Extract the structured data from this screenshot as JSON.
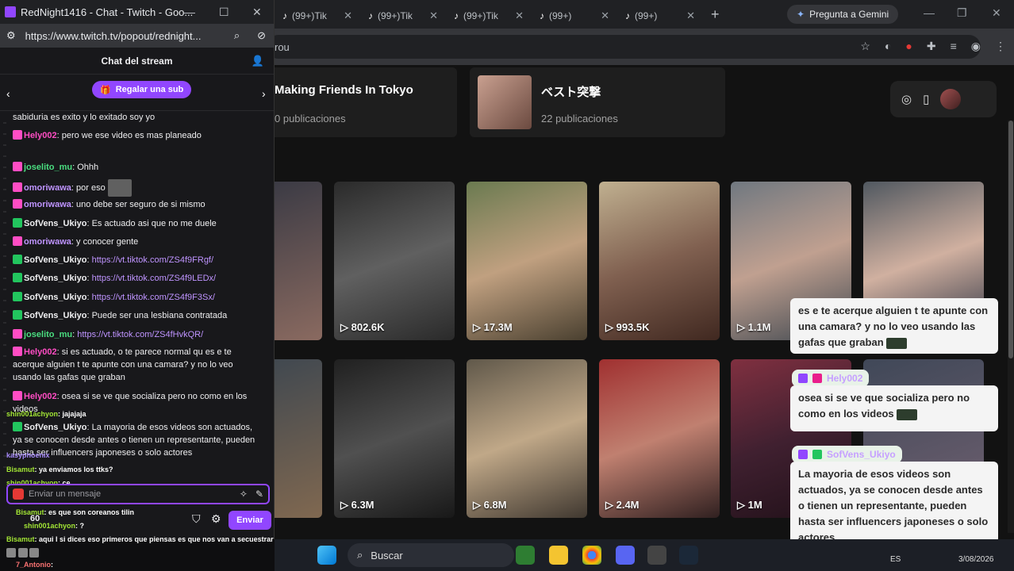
{
  "browser": {
    "tabs": [
      {
        "label": "(99+)Tik"
      },
      {
        "label": "(99+)Tik"
      },
      {
        "label": "(99+)Tik"
      },
      {
        "label": "(99+)"
      },
      {
        "label": "(99+)"
      }
    ],
    "gemini_label": "Pregunta a Gemini",
    "address_text": "rou"
  },
  "page": {
    "cards": [
      {
        "title": "Making Friends In Tokyo",
        "subtitle": "0 publicaciones"
      },
      {
        "title": "ベスト突撃",
        "subtitle": "22 publicaciones"
      }
    ],
    "videos_row1": [
      {
        "count": ""
      },
      {
        "count": "802.6K"
      },
      {
        "count": "17.3M"
      },
      {
        "count": "993.5K"
      },
      {
        "count": "1.1M"
      },
      {
        "count": ""
      }
    ],
    "videos_row2": [
      {
        "count": ""
      },
      {
        "count": "6.3M"
      },
      {
        "count": "6.8M"
      },
      {
        "count": "2.4M"
      },
      {
        "count": "1M"
      },
      {
        "count": ""
      }
    ]
  },
  "overlay": {
    "bubble1": "es e te acerque alguien t te apunte con una camara? y no lo veo usando las gafas que graban",
    "name2": "Hely002",
    "bubble2": "osea si se ve que socializa pero no como en los videos",
    "name3": "SofVens_Ukiyo",
    "bubble3": "La mayoria de esos videos son actuados, ya se conocen desde antes o tienen un representante, pueden hasta ser influencers japoneses o solo actores"
  },
  "taskbar": {
    "search_label": "Buscar",
    "lang": "ES",
    "date": "3/08/2026"
  },
  "popup": {
    "window_title": "RedNight1416 - Chat - Twitch - Goo...",
    "url": "https://www.twitch.tv/popout/rednight...",
    "chat_title": "Chat del stream",
    "gift_label": "Regalar una sub",
    "input_placeholder": "Enviar un mensaje",
    "send_label": "Enviar",
    "points": "60"
  },
  "messages": [
    {
      "user": "",
      "text": "sabiduria es exito y lo exitado soy yo",
      "color": "#efeff1"
    },
    {
      "user": "Hely002",
      "text": ": pero we ese video es mas planeado",
      "color": "#ff4dc4"
    },
    {
      "user": "joselito_mu",
      "text": ": Ohhh",
      "color": "#4ade80"
    },
    {
      "user": "omoriwawa",
      "text": ": por eso",
      "color": "#bf94ff"
    },
    {
      "user": "omoriwawa",
      "text": ": uno debe ser seguro de si mismo",
      "color": "#bf94ff"
    },
    {
      "user": "SofVens_Ukiyo",
      "text": ": Es actuado asi que no me duele",
      "color": "#efeff1"
    },
    {
      "user": "omoriwawa",
      "text": ": y conocer gente",
      "color": "#bf94ff"
    },
    {
      "user": "SofVens_Ukiyo",
      "text": ": ",
      "link": "https://vt.tiktok.com/ZS4f9FRgf/",
      "color": "#efeff1"
    },
    {
      "user": "SofVens_Ukiyo",
      "text": ": ",
      "link": "https://vt.tiktok.com/ZS4f9LEDx/",
      "color": "#efeff1"
    },
    {
      "user": "SofVens_Ukiyo",
      "text": ": ",
      "link": "https://vt.tiktok.com/ZS4f9F3Sx/",
      "color": "#efeff1"
    },
    {
      "user": "SofVens_Ukiyo",
      "text": ": Puede ser una lesbiana contratada",
      "color": "#efeff1"
    },
    {
      "user": "joselito_mu",
      "text": ": ",
      "link": "https://vt.tiktok.com/ZS4fHvkQR/",
      "color": "#4ade80"
    },
    {
      "user": "Hely002",
      "text": ": si es actuado, o te parece normal qu es e te acerque alguien t te apunte con una camara? y no lo veo usando las gafas que graban",
      "color": "#ff4dc4"
    },
    {
      "user": "Hely002",
      "text": ": osea si se ve que socializa pero no como en los videos",
      "color": "#ff4dc4"
    },
    {
      "user": "SofVens_Ukiyo",
      "text": ": La mayoria de esos videos son actuados, ya se conocen desde antes o tienen un representante, pueden hasta ser influencers japoneses o solo actores",
      "color": "#efeff1"
    }
  ],
  "overflow_lines": [
    {
      "user": "shin001achyon",
      "text": ": jajajaja",
      "color": "#a3e635"
    },
    {
      "user": "kasyphoenix",
      "text": "",
      "color": "#a78bfa"
    },
    {
      "user": "Bisamut",
      "text": ": ya enviamos los ttks?",
      "color": "#a3e635"
    },
    {
      "user": "shin001achyon",
      "text": ": ce",
      "color": "#a3e635"
    },
    {
      "user": "Bisamut",
      "text": ": es que son coreanos tilin",
      "color": "#a3e635"
    },
    {
      "user": "shin001achyon",
      "text": ": ?",
      "color": "#a3e635"
    },
    {
      "user": "Bisamut",
      "text": ": aqui l si dices eso primeros que piensas es que nos van a secuestrar",
      "color": "#a3e635"
    },
    {
      "user": "7_Antonio",
      "text": ":",
      "color": "#f87171"
    }
  ]
}
